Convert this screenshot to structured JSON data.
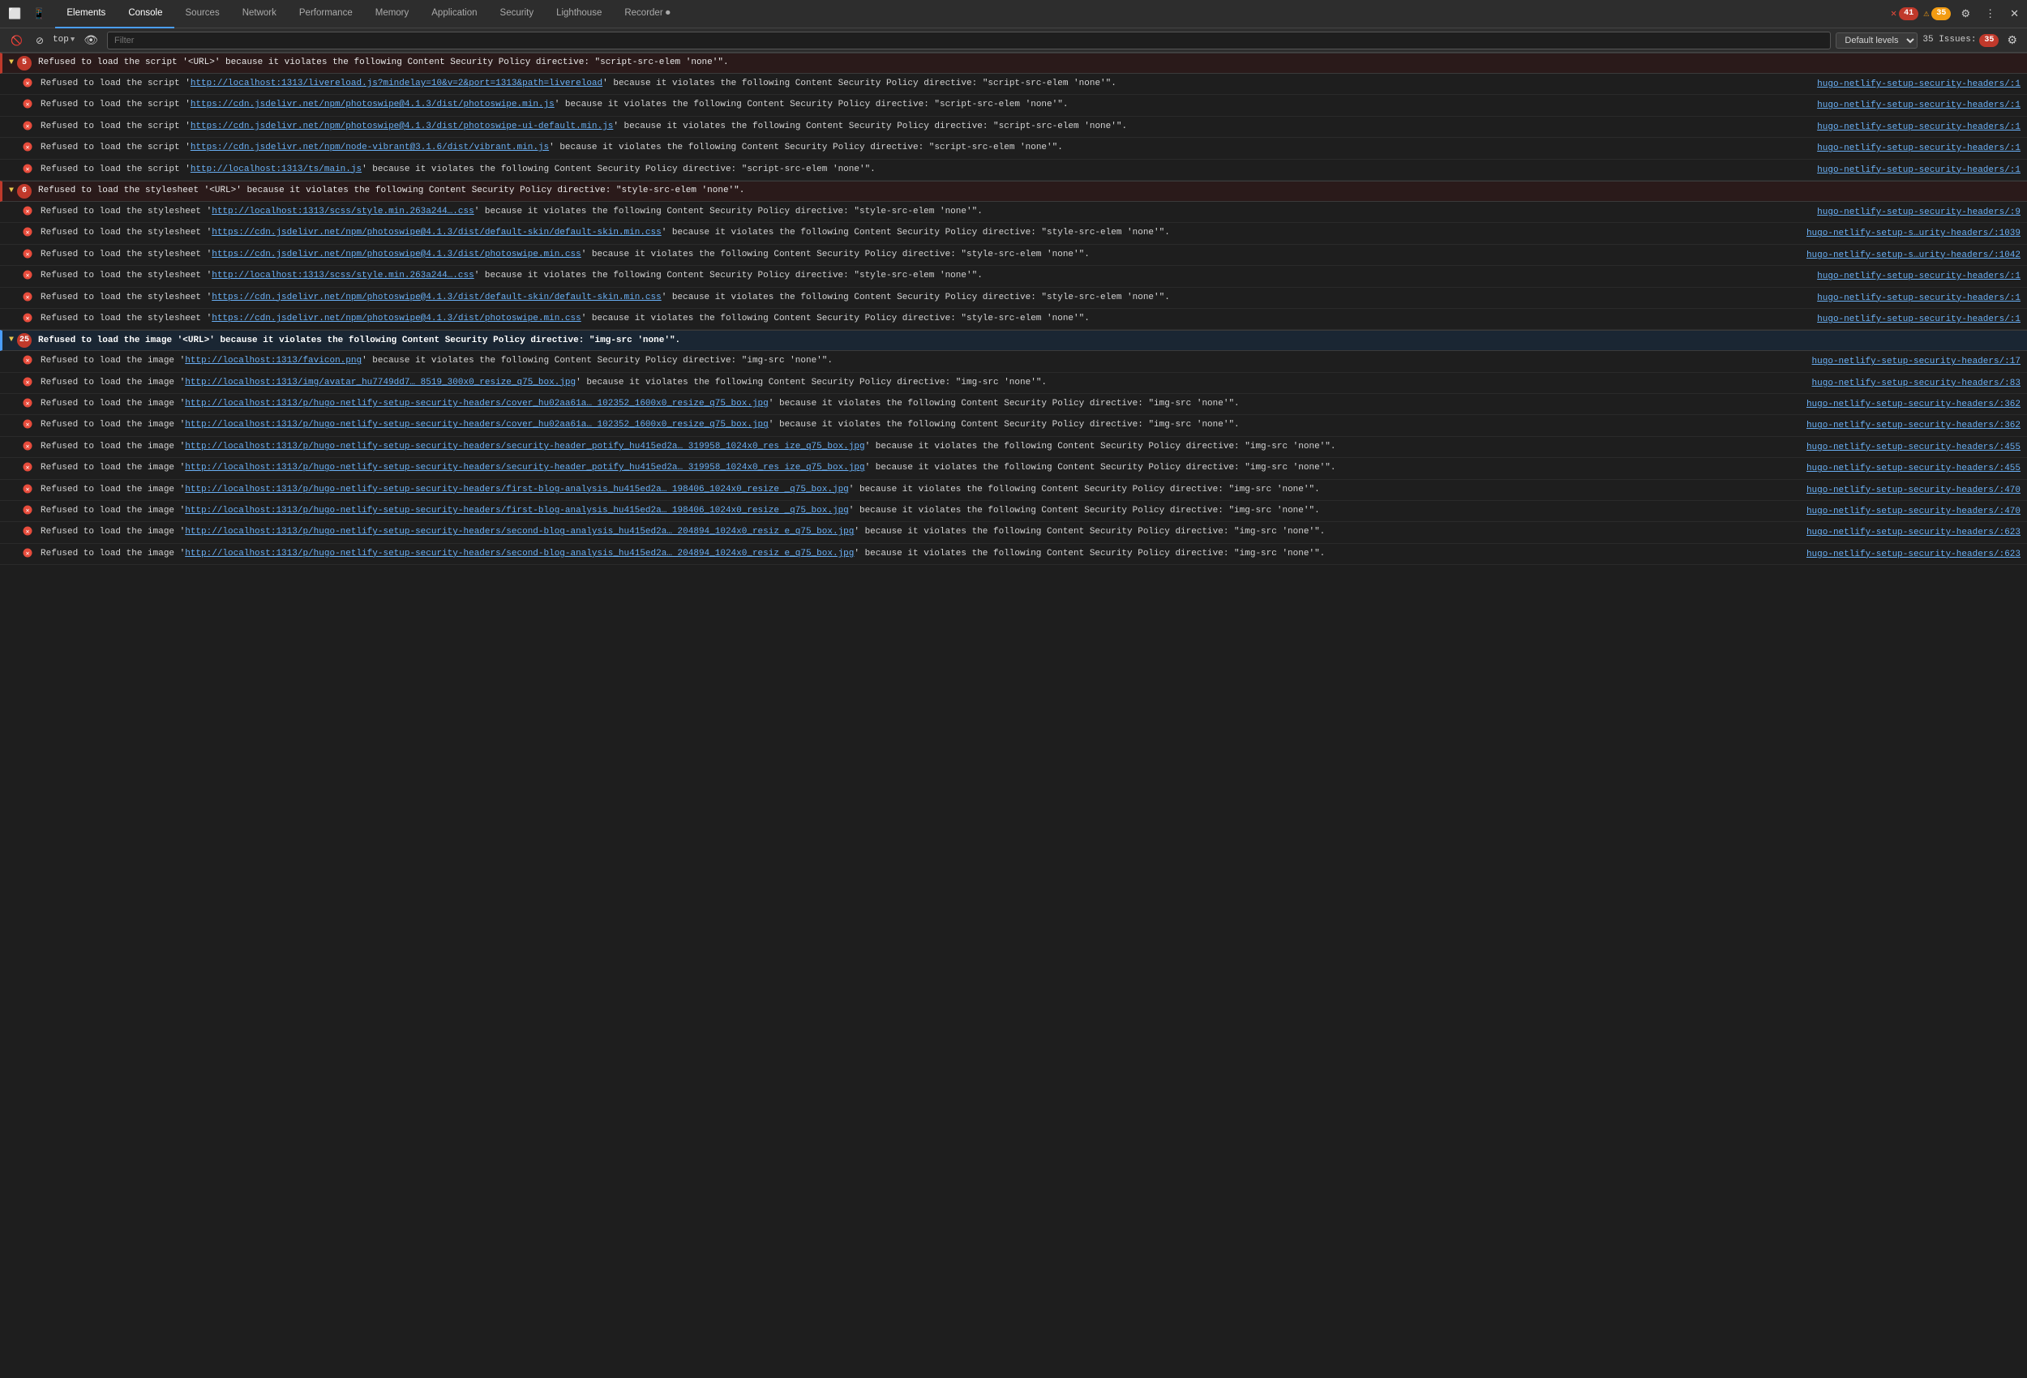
{
  "tabs": {
    "items": [
      {
        "label": "Elements",
        "active": false
      },
      {
        "label": "Console",
        "active": true
      },
      {
        "label": "Sources",
        "active": false
      },
      {
        "label": "Network",
        "active": false
      },
      {
        "label": "Performance",
        "active": false
      },
      {
        "label": "Memory",
        "active": false
      },
      {
        "label": "Application",
        "active": false
      },
      {
        "label": "Security",
        "active": false
      },
      {
        "label": "Lighthouse",
        "active": false
      },
      {
        "label": "Recorder ⏺",
        "active": false
      }
    ],
    "badge_errors": "41",
    "badge_warnings": "35"
  },
  "toolbar": {
    "filter_placeholder": "Filter",
    "level_label": "Default levels",
    "issues_label": "35 Issues:",
    "issues_count": "35",
    "top_label": "top"
  },
  "groups": [
    {
      "id": "group-scripts",
      "count": "5",
      "text": "Refused to load the script '<URL>' because it violates the following Content Security Policy directive: \"script-src-elem 'none'\".",
      "rows": [
        {
          "msg_start": "Refused to load the script '",
          "link_text": "http://localhost:1313/livereload.js?mindelay=10&v=2&port=1313&path=livereload",
          "msg_end": "' because it violates the following Content Security Policy directive: \"script-src-elem 'none'\".",
          "source": "hugo-netlify-setup-security-headers/:1"
        },
        {
          "msg_start": "Refused to load the script '",
          "link_text": "https://cdn.jsdelivr.net/npm/photoswipe@4.1.3/dist/photoswipe.min.js",
          "msg_end": "' because it violates the following Content Security Policy directive: \"script-src-elem 'none'\".",
          "source": "hugo-netlify-setup-security-headers/:1"
        },
        {
          "msg_start": "Refused to load the script '",
          "link_text": "https://cdn.jsdelivr.net/npm/photoswipe@4.1.3/dist/photoswipe-ui-default.min.js",
          "msg_end": "' because it violates the following Content Security Policy directive: \"script-src-elem 'none'\".",
          "source": "hugo-netlify-setup-security-headers/:1"
        },
        {
          "msg_start": "Refused to load the script '",
          "link_text": "https://cdn.jsdelivr.net/npm/node-vibrant@3.1.6/dist/vibrant.min.js",
          "msg_end": "' because it violates the following Content Security Policy directive: \"script-src-elem 'none'\".",
          "source": "hugo-netlify-setup-security-headers/:1"
        },
        {
          "msg_start": "Refused to load the script '",
          "link_text": "http://localhost:1313/ts/main.js",
          "msg_end": "' because it violates the following Content Security Policy directive: \"script-src-elem 'none'\".",
          "source": "hugo-netlify-setup-security-headers/:1"
        }
      ]
    },
    {
      "id": "group-styles",
      "count": "6",
      "text": "Refused to load the stylesheet '<URL>' because it violates the following Content Security Policy directive: \"style-src-elem 'none'\".",
      "rows": [
        {
          "msg_start": "Refused to load the stylesheet '",
          "link_text": "http://localhost:1313/scss/style.min.263a244….css",
          "msg_end": "' because it violates the following Content Security Policy directive: \"style-src-elem 'none'\".",
          "source": "hugo-netlify-setup-security-headers/:9"
        },
        {
          "msg_start": "Refused to load the stylesheet '",
          "link_text": "https://cdn.jsdelivr.net/npm/photoswipe@4.1.3/dist/default-skin/default-skin.min.css",
          "msg_end": "' because it violates the following Content Security Policy directive: \"style-src-elem 'none'\".",
          "source": "hugo-netlify-setup-s…urity-headers/:1039"
        },
        {
          "msg_start": "Refused to load the stylesheet '",
          "link_text": "https://cdn.jsdelivr.net/npm/photoswipe@4.1.3/dist/photoswipe.min.css",
          "msg_end": "' because it violates the following Content Security Policy directive: \"style-src-elem 'none'\".",
          "source": "hugo-netlify-setup-s…urity-headers/:1042"
        },
        {
          "msg_start": "Refused to load the stylesheet '",
          "link_text": "http://localhost:1313/scss/style.min.263a244….css",
          "msg_end": "' because it violates the following Content Security Policy directive: \"style-src-elem 'none'\".",
          "source": "hugo-netlify-setup-security-headers/:1"
        },
        {
          "msg_start": "Refused to load the stylesheet '",
          "link_text": "https://cdn.jsdelivr.net/npm/photoswipe@4.1.3/dist/default-skin/default-skin.min.css",
          "msg_end": "' because it violates the following Content Security Policy directive: \"style-src-elem 'none'\".",
          "source": "hugo-netlify-setup-security-headers/:1"
        },
        {
          "msg_start": "Refused to load the stylesheet '",
          "link_text": "https://cdn.jsdelivr.net/npm/photoswipe@4.1.3/dist/photoswipe.min.css",
          "msg_end": "' because it violates the following Content Security Policy directive: \"style-src-elem 'none'\".",
          "source": "hugo-netlify-setup-security-headers/:1"
        }
      ]
    },
    {
      "id": "group-images",
      "count": "25",
      "text": "Refused to load the image '<URL>' because it violates the following Content Security Policy directive: \"img-src 'none'\".",
      "highlight": true,
      "rows": [
        {
          "msg_start": "Refused to load the image '",
          "link_text": "http://localhost:1313/favicon.png",
          "msg_end": "' because it violates the following Content Security Policy directive: \"img-src 'none'\".",
          "source": "hugo-netlify-setup-security-headers/:17"
        },
        {
          "msg_start": "Refused to load the image '",
          "link_text": "http://localhost:1313/img/avatar_hu7749dd7… 8519_300x0_resize_q75_box.jpg",
          "msg_end": "' because it violates the following Content Security Policy directive: \"img-src 'none'\".",
          "source": "hugo-netlify-setup-security-headers/:83"
        },
        {
          "msg_start": "Refused to load the image '",
          "link_text": "http://localhost:1313/p/hugo-netlify-setup-security-headers/cover_hu02aa61a… 102352_1600x0_resize_q75_box.jpg",
          "msg_end": "' because it violates the following Content Security Policy directive: \"img-src 'none'\".",
          "source": "hugo-netlify-setup-security-headers/:362"
        },
        {
          "msg_start": "Refused to load the image '",
          "link_text": "http://localhost:1313/p/hugo-netlify-setup-security-headers/cover_hu02aa61a… 102352_1600x0_resize_q75_box.jpg",
          "msg_end": "' because it violates the following Content Security Policy directive: \"img-src 'none'\".",
          "source": "hugo-netlify-setup-security-headers/:362"
        },
        {
          "msg_start": "Refused to load the image '",
          "link_text": "http://localhost:1313/p/hugo-netlify-setup-security-headers/security-header_potify_hu415ed2a… 319958_1024x0_res ize_q75_box.jpg",
          "msg_end": "' because it violates the following Content Security Policy directive: \"img-src 'none'\".",
          "source": "hugo-netlify-setup-security-headers/:455"
        },
        {
          "msg_start": "Refused to load the image '",
          "link_text": "http://localhost:1313/p/hugo-netlify-setup-security-headers/security-header_potify_hu415ed2a… 319958_1024x0_res ize_q75_box.jpg",
          "msg_end": "' because it violates the following Content Security Policy directive: \"img-src 'none'\".",
          "source": "hugo-netlify-setup-security-headers/:455"
        },
        {
          "msg_start": "Refused to load the image '",
          "link_text": "http://localhost:1313/p/hugo-netlify-setup-security-headers/first-blog-analysis_hu415ed2a… 198406_1024x0_resize _q75_box.jpg",
          "msg_end": "' because it violates the following Content Security Policy directive: \"img-src 'none'\".",
          "source": "hugo-netlify-setup-security-headers/:470"
        },
        {
          "msg_start": "Refused to load the image '",
          "link_text": "http://localhost:1313/p/hugo-netlify-setup-security-headers/first-blog-analysis_hu415ed2a… 198406_1024x0_resize _q75_box.jpg",
          "msg_end": "' because it violates the following Content Security Policy directive: \"img-src 'none'\".",
          "source": "hugo-netlify-setup-security-headers/:470"
        },
        {
          "msg_start": "Refused to load the image '",
          "link_text": "http://localhost:1313/p/hugo-netlify-setup-security-headers/second-blog-analysis_hu415ed2a… 204894_1024x0_resiz e_q75_box.jpg",
          "msg_end": "' because it violates the following Content Security Policy directive: \"img-src 'none'\".",
          "source": "hugo-netlify-setup-security-headers/:623"
        },
        {
          "msg_start": "Refused to load the image '",
          "link_text": "http://localhost:1313/p/hugo-netlify-setup-security-headers/second-blog-analysis_hu415ed2a… 204894_1024x0_resiz e_q75_box.jpg",
          "msg_end": "' because it violates the following Content Security Policy directive: \"img-src 'none'\".",
          "source": "hugo-netlify-setup-security-headers/:623"
        }
      ]
    }
  ]
}
